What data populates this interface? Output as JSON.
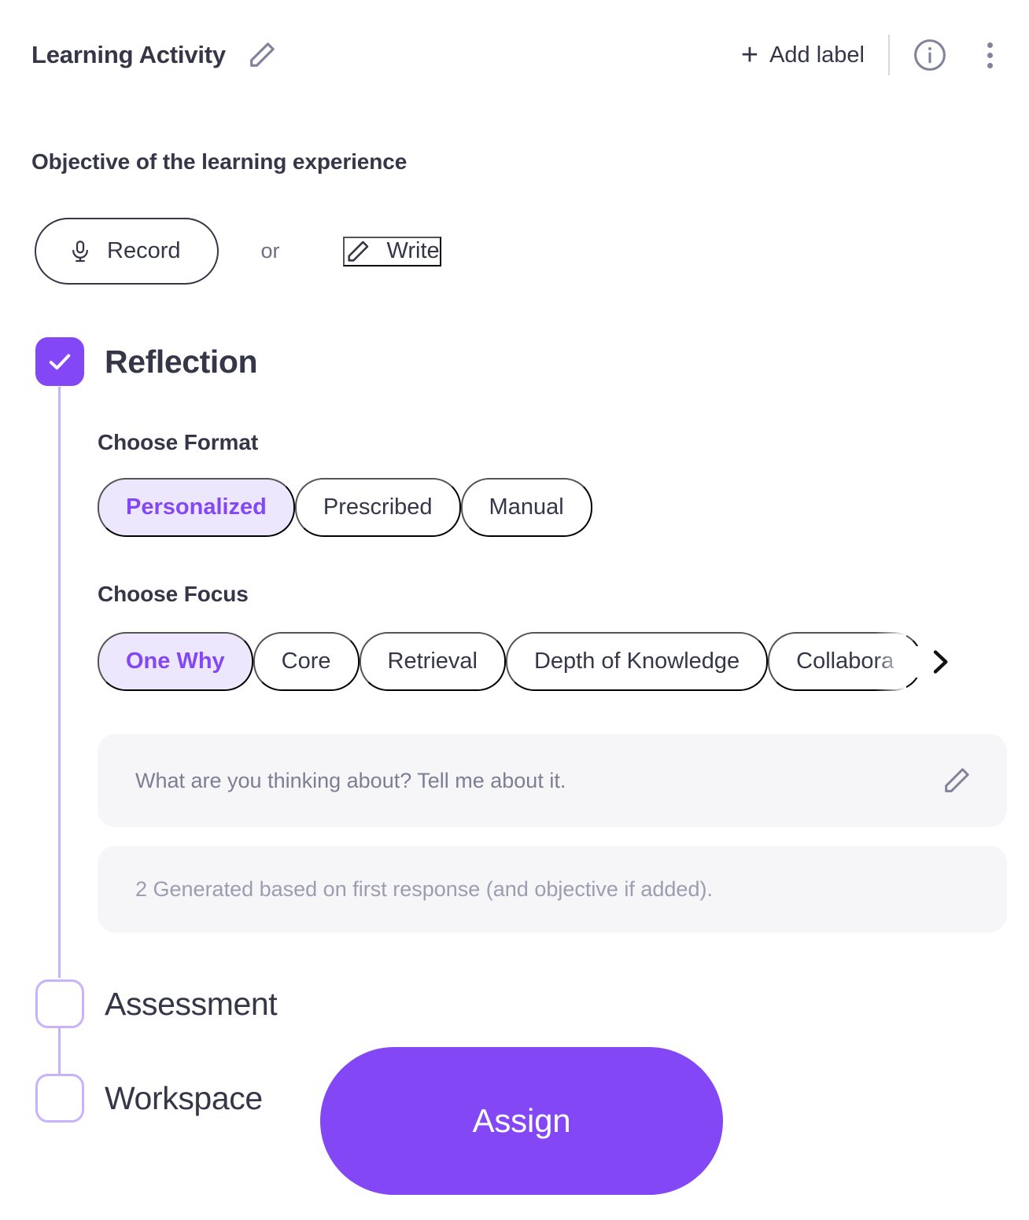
{
  "header": {
    "title": "Learning Activity",
    "edit_icon": "pencil-icon",
    "add_label": "Add label",
    "plus": "+",
    "info_icon": "info-circle-icon",
    "more_icon": "kebab-menu-icon"
  },
  "objective": {
    "heading": "Objective of the learning experience",
    "record_label": "Record",
    "record_icon": "microphone-icon",
    "or_label": "or",
    "write_label": "Write",
    "write_icon": "pencil-icon"
  },
  "steps": [
    {
      "label": "Reflection",
      "checked": true
    },
    {
      "label": "Assessment",
      "checked": false
    },
    {
      "label": "Workspace",
      "checked": false
    }
  ],
  "reflection": {
    "format": {
      "heading": "Choose Format",
      "options": [
        "Personalized",
        "Prescribed",
        "Manual"
      ],
      "selected": "Personalized"
    },
    "focus": {
      "heading": "Choose Focus",
      "options": [
        "One Why",
        "Core",
        "Retrieval",
        "Depth of Knowledge",
        "Collabora"
      ],
      "selected": "One Why",
      "next_icon": "chevron-right-icon"
    },
    "prompts": [
      {
        "text": "What are you thinking about? Tell me about it.",
        "edit_icon": "pencil-icon"
      },
      {
        "text": "2 Generated based on first response (and objective if added)."
      }
    ]
  },
  "footer": {
    "assign_label": "Assign"
  },
  "colors": {
    "accent": "#8347F5",
    "accent_soft": "#EDE7FD",
    "accent_line": "#C8B2FB",
    "text": "#353749",
    "muted": "#7C7F94",
    "surface": "#F6F6F8"
  }
}
